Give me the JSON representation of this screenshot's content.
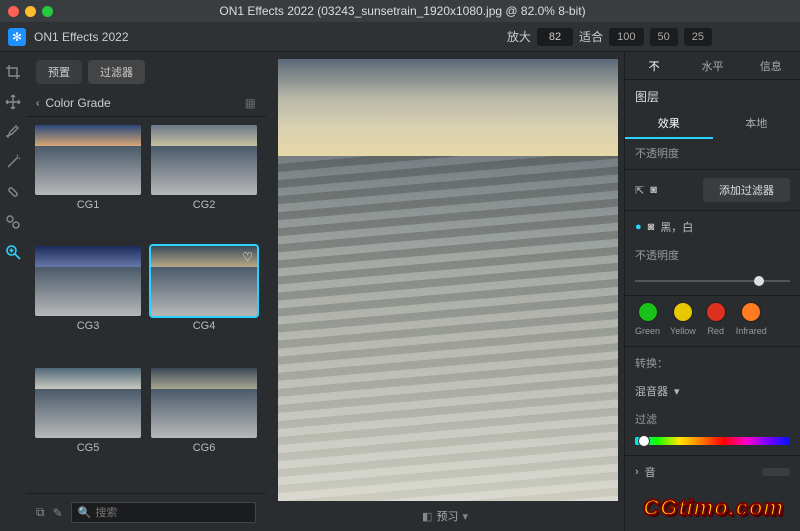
{
  "title": "ON1 Effects 2022 (03243_sunsetrain_1920x1080.jpg @ 82.0% 8-bit)",
  "brand": "ON1 Effects 2022",
  "zoom": {
    "label": "放大",
    "value": "82",
    "fit": "适合",
    "p100": "100",
    "p50": "50",
    "p25": "25"
  },
  "left": {
    "tabs": {
      "preset": "预置",
      "filter": "过滤器"
    },
    "category": "Color Grade",
    "presets": [
      {
        "label": "CG1",
        "cls": "cg1"
      },
      {
        "label": "CG2",
        "cls": "cg2"
      },
      {
        "label": "CG3",
        "cls": "cg3"
      },
      {
        "label": "CG4",
        "cls": "cg4",
        "selected": true
      },
      {
        "label": "CG5",
        "cls": "cg5"
      },
      {
        "label": "CG6",
        "cls": "cg6"
      }
    ],
    "search_placeholder": "搜索"
  },
  "center": {
    "preview": "预习"
  },
  "right": {
    "top": {
      "no": "不",
      "level": "水平",
      "info": "信息"
    },
    "layers_title": "图层",
    "tabs": {
      "effects": "效果",
      "local": "本地"
    },
    "opacity": "不透明度",
    "add_filter": "添加过滤器",
    "layer_name": "黑，白",
    "opacity2": "不透明度",
    "colors": [
      {
        "name": "Green",
        "hex": "#18c218"
      },
      {
        "name": "Yellow",
        "hex": "#e8c800"
      },
      {
        "name": "Red",
        "hex": "#e03020"
      },
      {
        "name": "Infrared",
        "hex": "#ff7a20"
      }
    ],
    "convert_label": "转换：",
    "convert_value": "混音器",
    "filter_label": "过滤",
    "sound": "音"
  },
  "watermark": "CGtimo.com"
}
